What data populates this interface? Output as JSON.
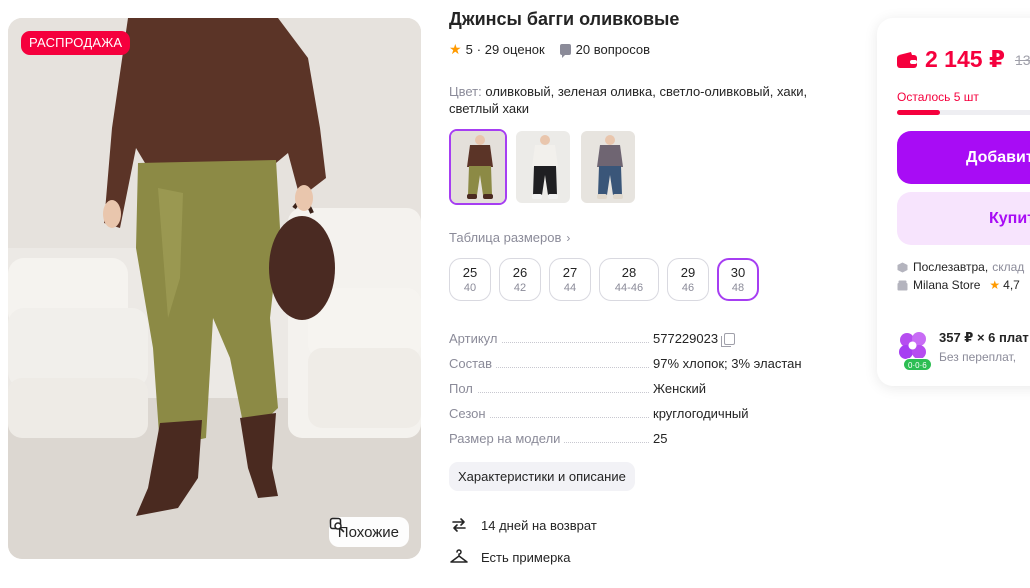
{
  "gallery": {
    "badge": "РАСПРОДАЖА",
    "similar_label": "Похожие"
  },
  "product": {
    "title": "Джинсы багги оливковые",
    "rating": "5",
    "reviews": "· 29 оценок",
    "questions": "20 вопросов",
    "color_label": "Цвет:",
    "color_value": "оливковый, зеленая оливка, светло-оливковый, хаки, светлый хаки"
  },
  "swatches": [
    {
      "variant": "olive",
      "selected": true
    },
    {
      "variant": "black",
      "selected": false
    },
    {
      "variant": "blue",
      "selected": false
    }
  ],
  "size_table_label": "Таблица размеров",
  "sizes": [
    {
      "ru": "25",
      "eu": "40",
      "selected": false
    },
    {
      "ru": "26",
      "eu": "42",
      "selected": false
    },
    {
      "ru": "27",
      "eu": "44",
      "selected": false
    },
    {
      "ru": "28",
      "eu": "44-46",
      "selected": false
    },
    {
      "ru": "29",
      "eu": "46",
      "selected": false
    },
    {
      "ru": "30",
      "eu": "48",
      "selected": true
    }
  ],
  "params": [
    {
      "key": "Артикул",
      "value": "577229023",
      "copy": true
    },
    {
      "key": "Состав",
      "value": "97% хлопок; 3% эластан"
    },
    {
      "key": "Пол",
      "value": "Женский"
    },
    {
      "key": "Сезон",
      "value": "круглогодичный"
    },
    {
      "key": "Размер на модели",
      "value": "25"
    }
  ],
  "specs_button": "Характеристики и описание",
  "features": {
    "return": "14 дней на возврат",
    "fitting": "Есть примерка"
  },
  "panel": {
    "price": "2 145 ₽",
    "old_price": "13",
    "stock_label": "Осталось 5 шт",
    "stock_fraction": 0.27,
    "add_to_cart": "Добавит",
    "buy_now": "Купит",
    "delivery": "Послезавтра,",
    "delivery_rest": "склад",
    "store": "Milana Store",
    "store_rating": "4,7",
    "installment_main": "357 ₽ × 6 плат",
    "installment_sub": "Без переплат,",
    "installment_badge": "0·0·6"
  },
  "colors": {
    "accent": "#a80cf5",
    "accent_light": "#f7e4fd",
    "sale_red": "#f5003d",
    "star": "#ff9a00",
    "muted": "#8b8b99"
  }
}
